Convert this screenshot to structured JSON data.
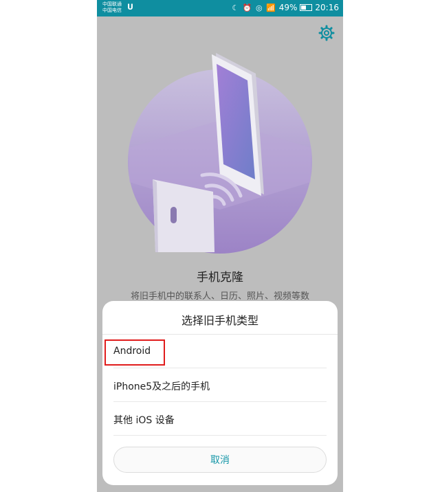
{
  "status_bar": {
    "carrier_1": "中国联通",
    "carrier_2": "中国电信",
    "usb_icon": "usb-icon",
    "icons": "☾ ⏰ ◎ 📶",
    "battery_percent": "49%",
    "time": "20:16",
    "battery_level": 0.49,
    "background": "#0f8ea0"
  },
  "app": {
    "settings_icon": "gear-icon",
    "title": "手机克隆",
    "description": "将旧手机中的联系人、日历、照片、视频等数"
  },
  "sheet": {
    "title": "选择旧手机类型",
    "options": [
      {
        "label": "Android"
      },
      {
        "label": "iPhone5及之后的手机"
      },
      {
        "label": "其他 iOS 设备"
      }
    ],
    "cancel_label": "取消",
    "accent_color": "#1597a8",
    "highlight_color": "#e01b1b"
  }
}
